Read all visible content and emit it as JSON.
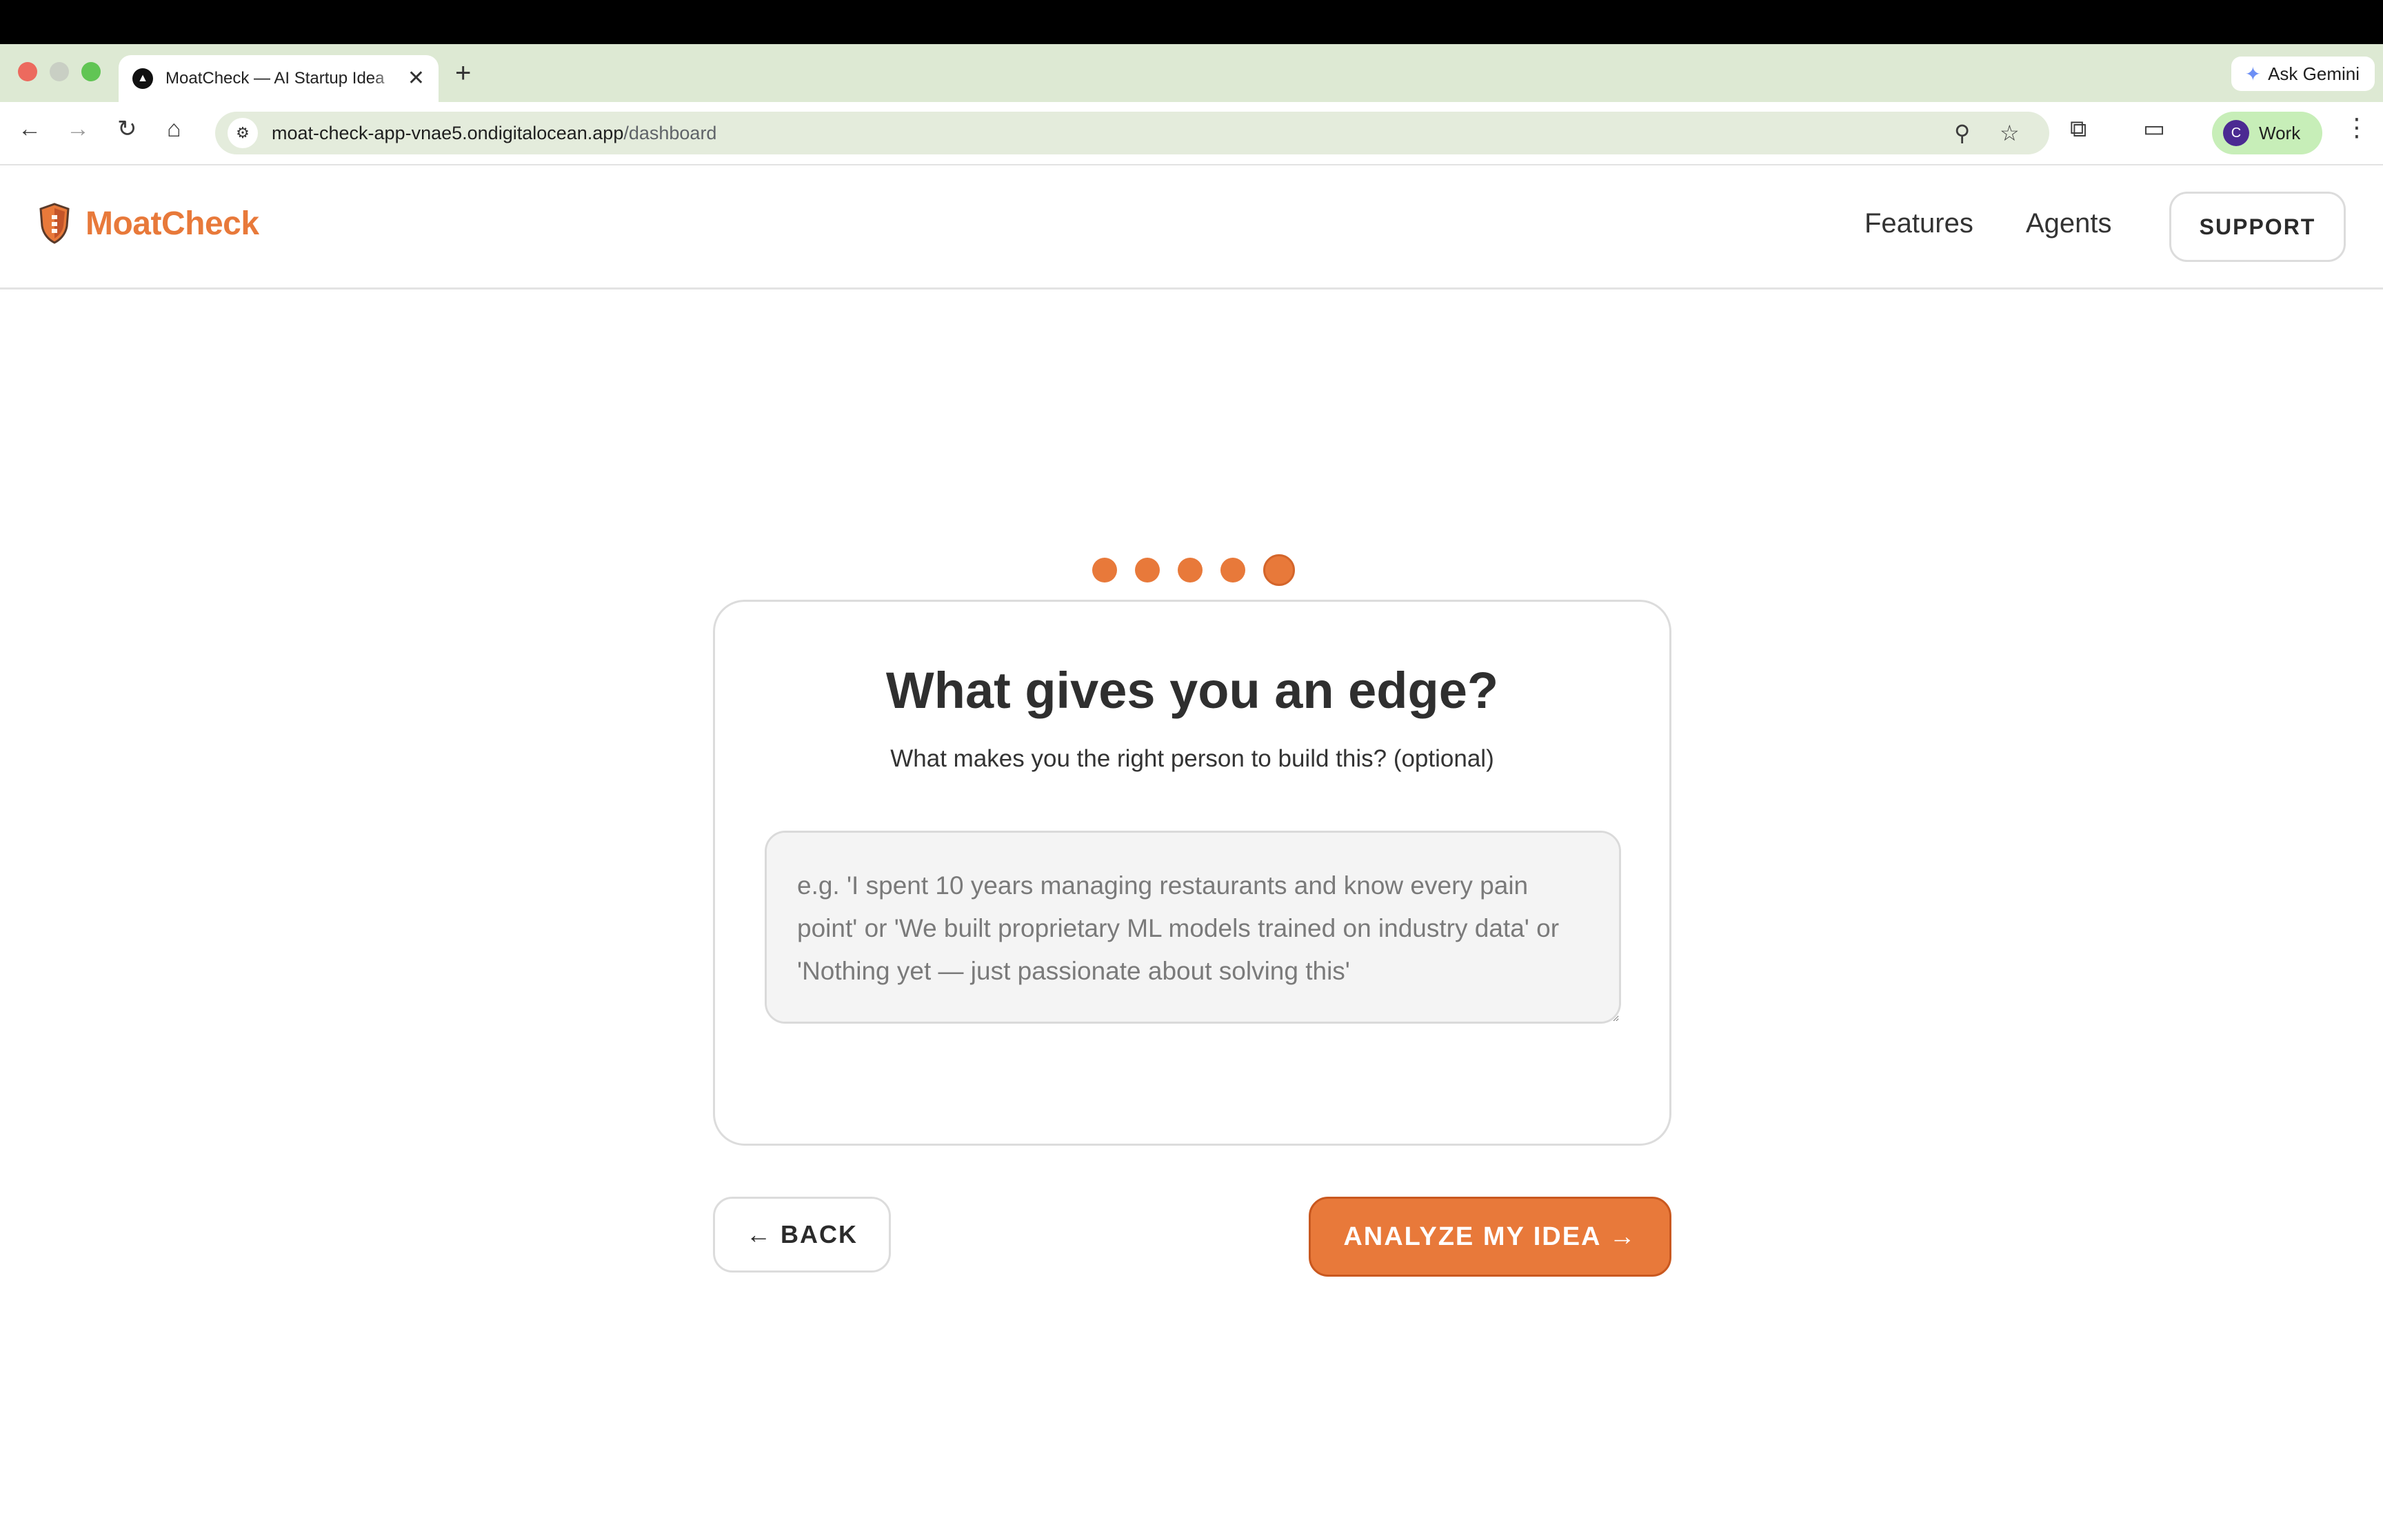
{
  "browser": {
    "tab_title": "MoatCheck — AI Startup Idea",
    "tab_close": "✕",
    "new_tab": "+",
    "gemini_label": "Ask Gemini",
    "url_host": "moat-check-app-vnae5.ondigitalocean.app",
    "url_path": "/dashboard",
    "profile_initial": "C",
    "profile_label": "Work"
  },
  "header": {
    "logo_text": "MoatCheck",
    "nav": [
      "Features",
      "Agents"
    ],
    "support_label": "SUPPORT"
  },
  "stepper": {
    "total_steps": 5,
    "current_step": 5
  },
  "card": {
    "title": "What gives you an edge?",
    "subtitle": "What makes you the right person to build this? (optional)",
    "textarea_placeholder": "e.g. 'I spent 10 years managing restaurants and know every pain point' or 'We built proprietary ML models trained on industry data' or 'Nothing yet — just passionate about solving this'",
    "textarea_value": ""
  },
  "actions": {
    "back_label": "← BACK",
    "analyze_label": "ANALYZE MY IDEA →"
  },
  "colors": {
    "accent": "#e8793a",
    "tab_strip": "#dde9d3",
    "omnibox": "#e4ecdc"
  },
  "icons": {
    "back": "arrow-left-icon",
    "forward": "arrow-right-icon",
    "reload": "reload-icon",
    "home": "home-icon",
    "site_info": "tune-icon",
    "zoom": "zoom-icon",
    "bookmark": "star-icon",
    "extensions": "puzzle-icon",
    "tab_search": "tab-search-icon",
    "menu": "more-vert-icon",
    "logo": "shield-icon"
  }
}
